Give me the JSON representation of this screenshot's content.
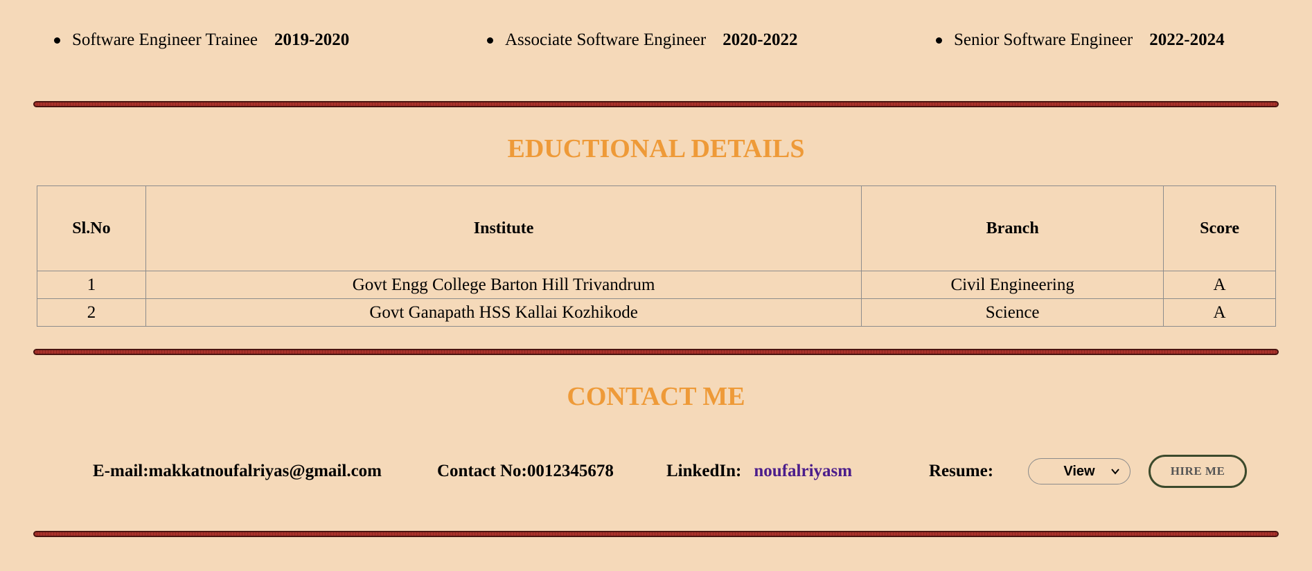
{
  "experience": [
    {
      "role": "Software Engineer Trainee",
      "years": "2019-2020"
    },
    {
      "role": "Associate Software Engineer",
      "years": "2020-2022"
    },
    {
      "role": "Senior Software Engineer",
      "years": "2022-2024"
    }
  ],
  "education": {
    "title": "EDUCTIONAL DETAILS",
    "headers": [
      "Sl.No",
      "Institute",
      "Branch",
      "Score"
    ],
    "rows": [
      [
        "1",
        "Govt Engg College Barton Hill Trivandrum",
        "Civil Engineering",
        "A"
      ],
      [
        "2",
        "Govt Ganapath HSS Kallai Kozhikode",
        "Science",
        "A"
      ]
    ]
  },
  "contact": {
    "title": "CONTACT ME",
    "email": "E-mail:makkatnoufalriyas@gmail.com",
    "phone": "Contact No:0012345678",
    "linkedin_label": "LinkedIn:",
    "linkedin_link": "noufalriyasm",
    "resume_label": "Resume:",
    "resume_selected": "View",
    "hire_label": "HIRE ME"
  },
  "colors": {
    "background": "#f5d9b9",
    "heading": "#ee9a38",
    "divider": "#a8322b",
    "link": "#4b1d8b"
  }
}
